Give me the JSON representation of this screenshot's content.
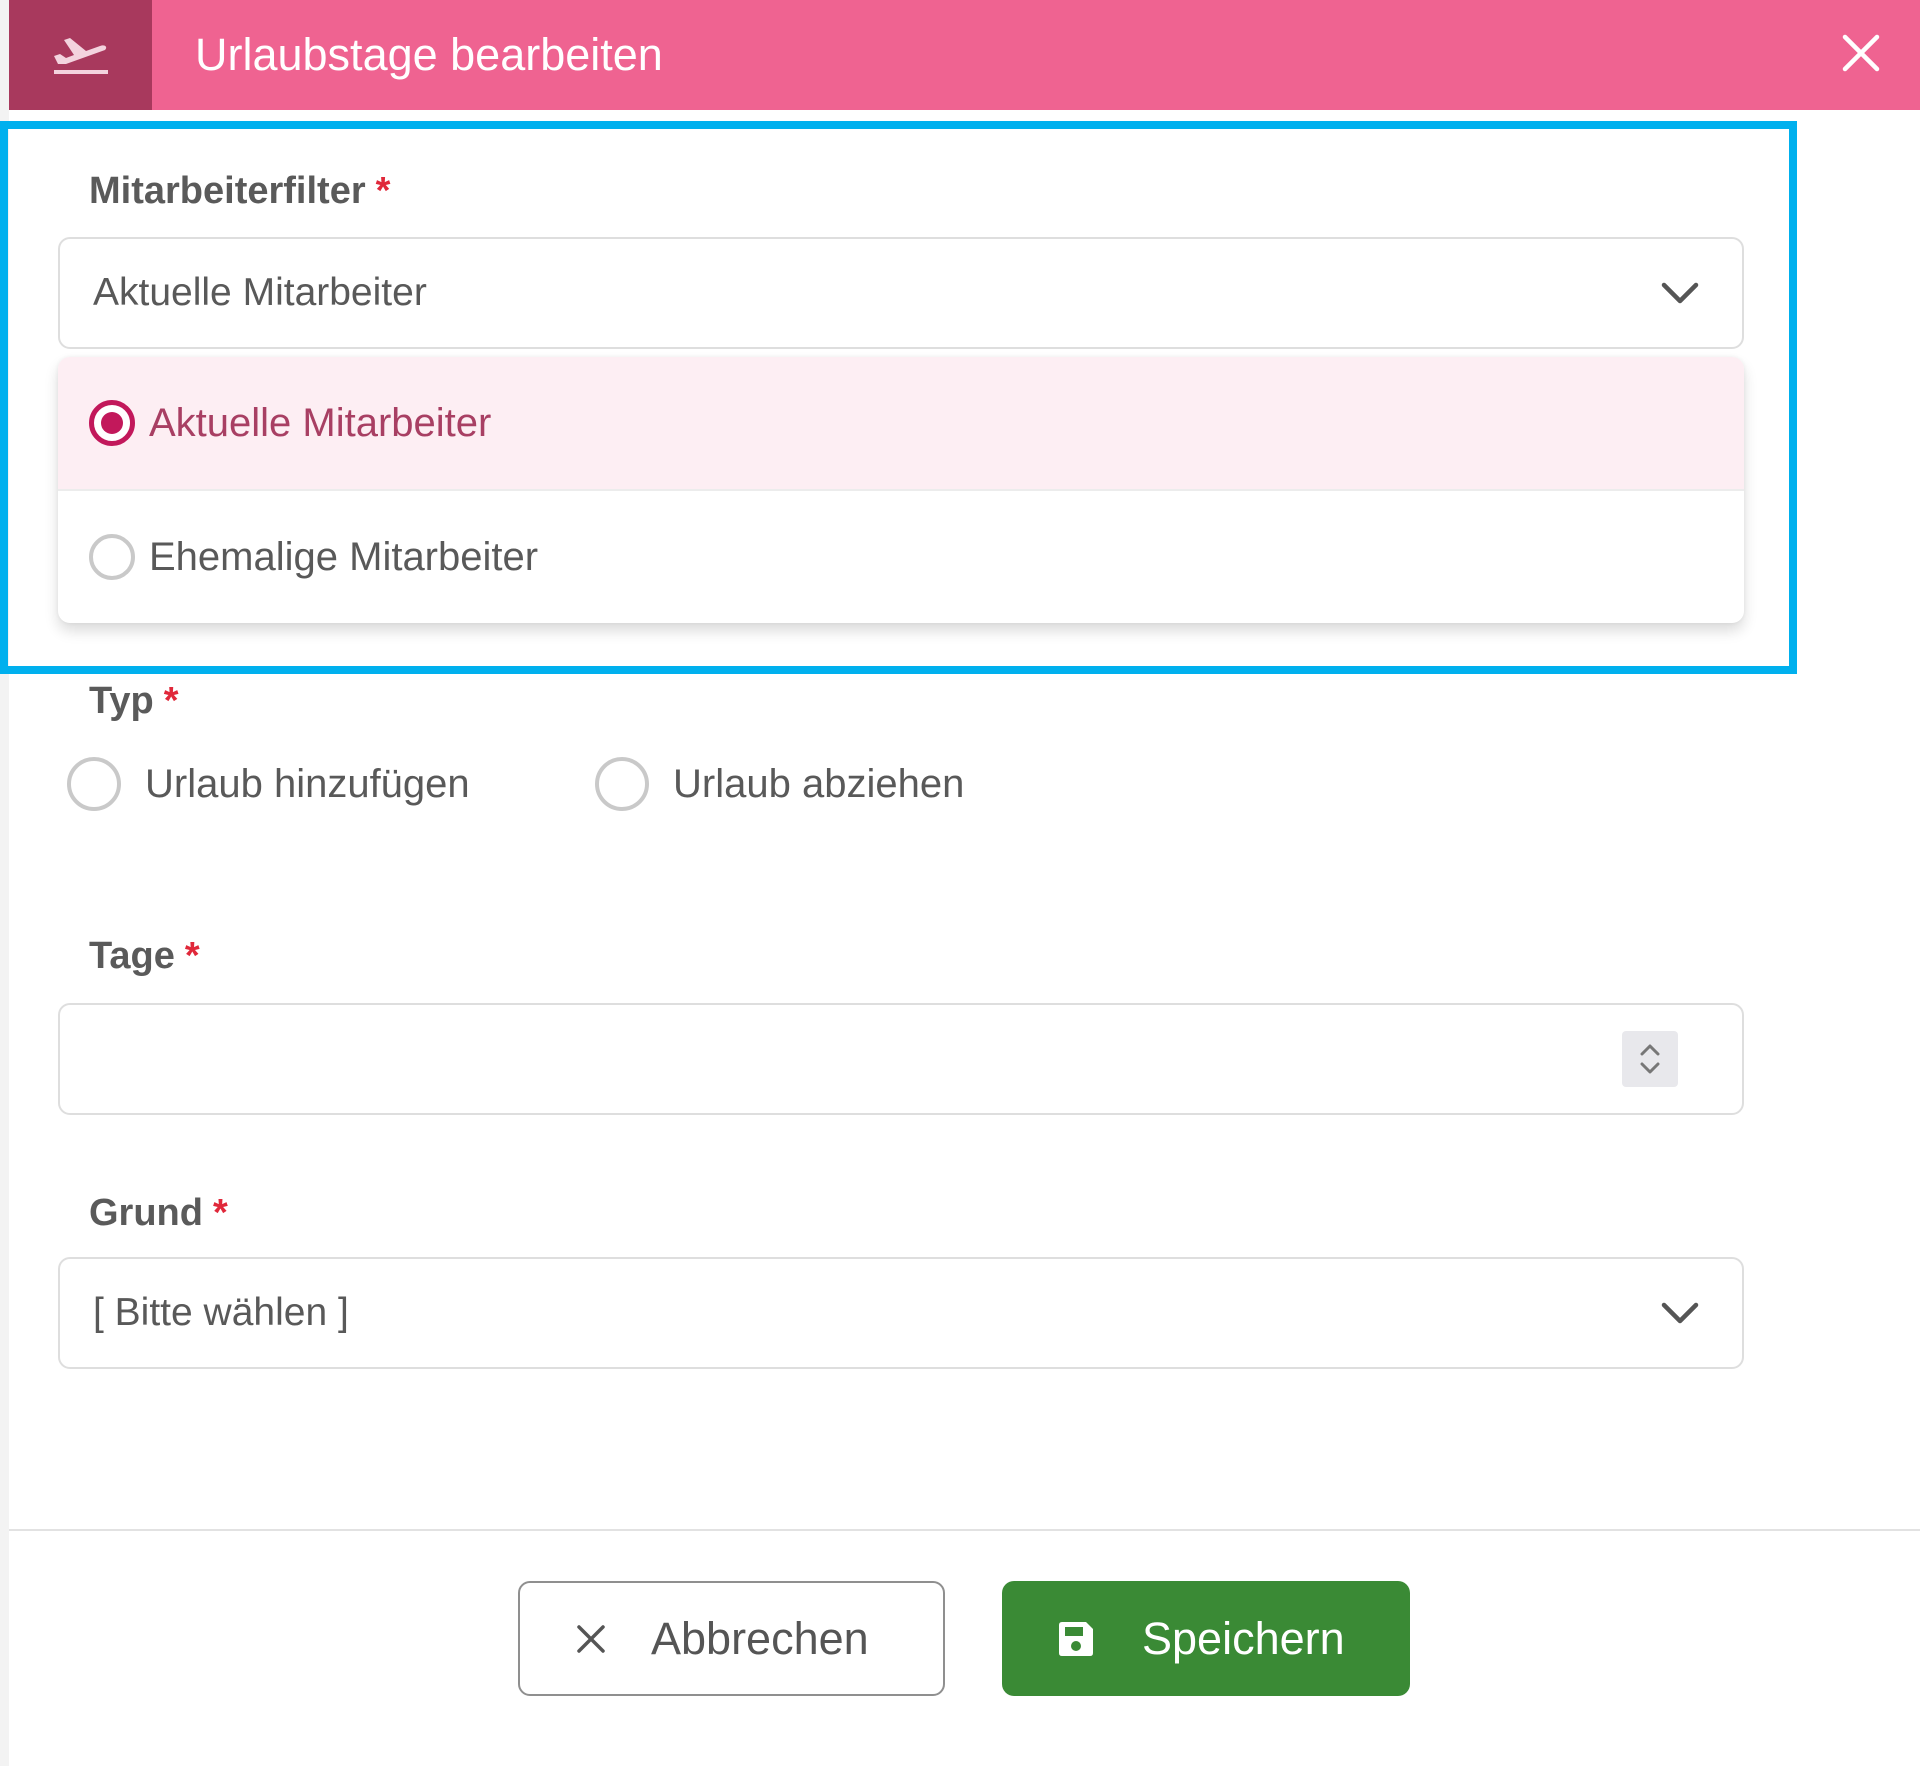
{
  "dialog": {
    "title": "Urlaubstage bearbeiten",
    "header_color": "#ef6391",
    "icon_box_color": "#a8395d",
    "icons": {
      "header": "plane-takeoff-icon",
      "close": "close-icon"
    }
  },
  "filter": {
    "label": "Mitarbeiterfilter",
    "required_marker": "*",
    "selected_value": "Aktuelle Mitarbeiter",
    "options": [
      {
        "label": "Aktuelle Mitarbeiter",
        "selected": true
      },
      {
        "label": "Ehemalige Mitarbeiter",
        "selected": false
      }
    ]
  },
  "typ": {
    "label": "Typ",
    "required_marker": "*",
    "options": [
      {
        "label": "Urlaub hinzufügen",
        "selected": false
      },
      {
        "label": "Urlaub abziehen",
        "selected": false
      }
    ]
  },
  "tage": {
    "label": "Tage",
    "required_marker": "*",
    "value": ""
  },
  "grund": {
    "label": "Grund",
    "required_marker": "*",
    "selected_value": "[ Bitte wählen ]"
  },
  "footer": {
    "cancel_label": "Abbrechen",
    "save_label": "Speichern",
    "save_color": "#3a8a35"
  },
  "highlight_color": "#00b0ee"
}
